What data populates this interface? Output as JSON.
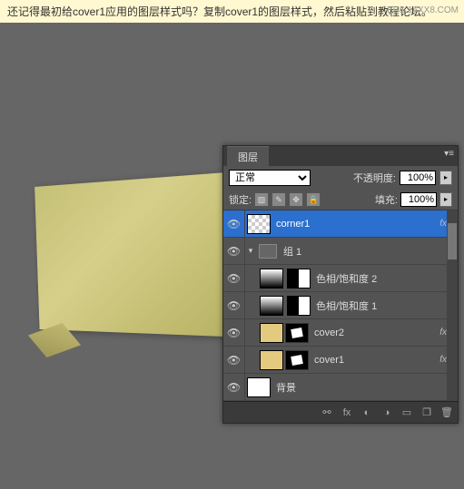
{
  "instruction": "还记得最初给cover1应用的图层样式吗？复制cover1的图层样式，然后粘贴到教程论坛。",
  "watermark": "BBS.16XX8.COM",
  "panel": {
    "tab": "图层",
    "blend_mode": "正常",
    "opacity_label": "不透明度:",
    "opacity_value": "100%",
    "lock_label": "锁定:",
    "fill_label": "填充:",
    "fill_value": "100%"
  },
  "layers": [
    {
      "name": "corner1",
      "selected": true,
      "fx": true,
      "thumb": "checker"
    },
    {
      "name": "组 1",
      "group": true
    },
    {
      "name": "色相/饱和度 2",
      "indent": 1,
      "adj": true
    },
    {
      "name": "色相/饱和度 1",
      "indent": 1,
      "adj": true
    },
    {
      "name": "cover2",
      "indent": 1,
      "fx": true,
      "thumb": "gold",
      "mask": true
    },
    {
      "name": "cover1",
      "indent": 1,
      "fx": true,
      "thumb": "gold",
      "mask": true
    },
    {
      "name": "背景",
      "thumb": "white"
    }
  ],
  "fx_text": "fx"
}
